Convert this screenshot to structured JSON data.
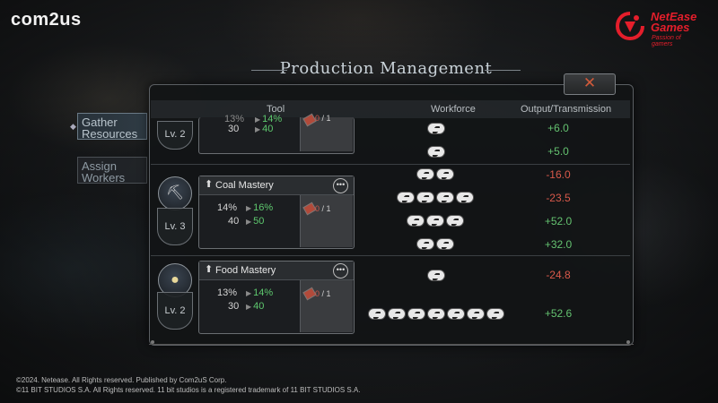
{
  "brand": {
    "com2us": "com2us",
    "netease_name": "NetEase Games",
    "netease_line1": "NetEase",
    "netease_line2": "Games",
    "netease_tagline": "Passion of gamers",
    "netease_color": "#e41e2b"
  },
  "window": {
    "title": "Production Management",
    "close_icon": "close-x-icon"
  },
  "side_tabs": [
    {
      "label": "Gather Resources",
      "active": true
    },
    {
      "label": "Assign Workers",
      "active": false
    }
  ],
  "columns": {
    "tool": "Tool",
    "workforce": "Workforce",
    "output": "Output/Transmission"
  },
  "skills": [
    {
      "name": "",
      "level": "Lv. 2",
      "icon": "partial-icon",
      "current_pct": "13%",
      "next_pct": "14%",
      "current_workers": "30",
      "next_workers": "40",
      "tool_count": "0",
      "tool_max": "1",
      "rows": [
        {
          "workers": 1,
          "output": "+6.0",
          "sign": "pos"
        },
        {
          "workers": 1,
          "output": "+5.0",
          "sign": "pos"
        }
      ]
    },
    {
      "name": "Coal Mastery",
      "level": "Lv. 3",
      "icon": "coal-icon",
      "current_pct": "14%",
      "next_pct": "16%",
      "current_workers": "40",
      "next_workers": "50",
      "tool_count": "0",
      "tool_max": "1",
      "rows": [
        {
          "workers": 2,
          "output": "-16.0",
          "sign": "neg"
        },
        {
          "workers": 4,
          "output": "-23.5",
          "sign": "neg"
        },
        {
          "workers": 3,
          "output": "+52.0",
          "sign": "pos"
        },
        {
          "workers": 2,
          "output": "+32.0",
          "sign": "pos"
        }
      ]
    },
    {
      "name": "Food Mastery",
      "level": "Lv. 2",
      "icon": "food-icon",
      "current_pct": "13%",
      "next_pct": "14%",
      "current_workers": "30",
      "next_workers": "40",
      "tool_count": "0",
      "tool_max": "1",
      "rows": [
        {
          "workers": 1,
          "output": "-24.8",
          "sign": "neg"
        },
        {
          "workers": 7,
          "output": "+52.6",
          "sign": "pos"
        }
      ]
    }
  ],
  "copyright": {
    "line1": "©2024. Netease. All Rights reserved. Published by Com2uS Corp.",
    "line2": "©11 BIT STUDIOS S.A. All Rights reserved. 11 bit studios is a registered trademark of 11 BIT STUDIOS S.A."
  }
}
